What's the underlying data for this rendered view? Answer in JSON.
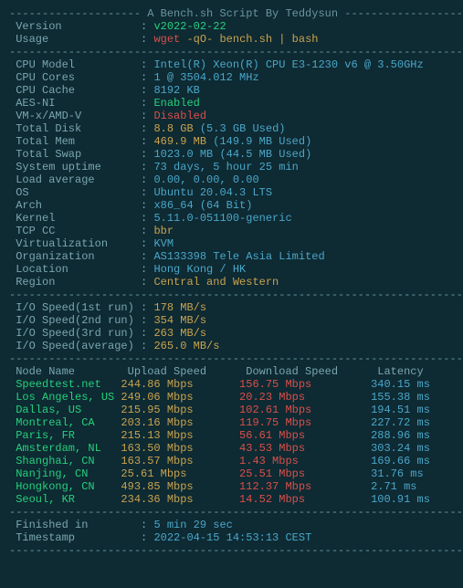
{
  "header": "-------------------- A Bench.sh Script By Teddysun --------------------",
  "sep": "-----------------------------------------------------------------------",
  "sep2": "----------------------------------------------------------------------",
  "meta": {
    "version_lbl": " Version            ",
    "version": "v2022-02-22",
    "usage_lbl": " Usage              ",
    "usage_w": "wget",
    "usage_o": " -qO- ",
    "usage_b": "bench.sh ",
    "usage_p": "|",
    "usage_ba": " bash"
  },
  "sys": {
    "cpu_model_lbl": " CPU Model          ",
    "cpu_model": "Intel(R) Xeon(R) CPU E3-1230 v6 @ 3.50GHz",
    "cpu_cores_lbl": " CPU Cores          ",
    "cpu_cores": "1 @ 3504.012 MHz",
    "cpu_cache_lbl": " CPU Cache          ",
    "cpu_cache": "8192 KB",
    "aesni_lbl": " AES-NI             ",
    "aesni": "Enabled",
    "vmx_lbl": " VM-x/AMD-V         ",
    "vmx": "Disabled",
    "disk_lbl": " Total Disk         ",
    "disk": "8.8 GB ",
    "disk_used": "(5.3 GB Used)",
    "mem_lbl": " Total Mem          ",
    "mem": "469.9 MB ",
    "mem_used": "(149.9 MB Used)",
    "swap_lbl": " Total Swap         ",
    "swap": "1023.0 MB ",
    "swap_used": "(44.5 MB Used)",
    "uptime_lbl": " System uptime      ",
    "uptime": "73 days, 5 hour 25 min",
    "load_lbl": " Load average       ",
    "load": "0.00, 0.00, 0.00",
    "os_lbl": " OS                 ",
    "os": "Ubuntu 20.04.3 LTS",
    "arch_lbl": " Arch               ",
    "arch": "x86_64 (64 Bit)",
    "kernel_lbl": " Kernel             ",
    "kernel": "5.11.0-051100-generic",
    "tcpcc_lbl": " TCP CC             ",
    "tcpcc": "bbr",
    "virt_lbl": " Virtualization     ",
    "virt": "KVM",
    "org_lbl": " Organization       ",
    "org": "AS133398 Tele Asia Limited",
    "loc_lbl": " Location           ",
    "loc": "Hong Kong / HK",
    "region_lbl": " Region             ",
    "region": "Central and Western"
  },
  "io": {
    "r1_lbl": " I/O Speed(1st run) ",
    "r1": "178 MB/s",
    "r2_lbl": " I/O Speed(2nd run) ",
    "r2": "354 MB/s",
    "r3_lbl": " I/O Speed(3rd run) ",
    "r3": "263 MB/s",
    "avg_lbl": " I/O Speed(average) ",
    "avg": "265.0 MB/s"
  },
  "net_hdr": " Node Name        Upload Speed      Download Speed      Latency    ",
  "net": [
    {
      "n": " Speedtest.net   ",
      "u": "244.86 Mbps       ",
      "d": "156.75 Mbps         ",
      "l": "340.15 ms"
    },
    {
      "n": " Los Angeles, US ",
      "u": "249.06 Mbps       ",
      "d": "20.23 Mbps          ",
      "l": "155.38 ms"
    },
    {
      "n": " Dallas, US      ",
      "u": "215.95 Mbps       ",
      "d": "102.61 Mbps         ",
      "l": "194.51 ms"
    },
    {
      "n": " Montreal, CA    ",
      "u": "203.16 Mbps       ",
      "d": "119.75 Mbps         ",
      "l": "227.72 ms"
    },
    {
      "n": " Paris, FR       ",
      "u": "215.13 Mbps       ",
      "d": "56.61 Mbps          ",
      "l": "288.96 ms"
    },
    {
      "n": " Amsterdam, NL   ",
      "u": "163.50 Mbps       ",
      "d": "43.53 Mbps          ",
      "l": "303.24 ms"
    },
    {
      "n": " Shanghai, CN    ",
      "u": "163.57 Mbps       ",
      "d": "1.43 Mbps           ",
      "l": "169.66 ms"
    },
    {
      "n": " Nanjing, CN     ",
      "u": "25.61 Mbps        ",
      "d": "25.51 Mbps          ",
      "l": "31.76 ms"
    },
    {
      "n": " Hongkong, CN    ",
      "u": "493.85 Mbps       ",
      "d": "112.37 Mbps         ",
      "l": "2.71 ms"
    },
    {
      "n": " Seoul, KR       ",
      "u": "234.36 Mbps       ",
      "d": "14.52 Mbps          ",
      "l": "100.91 ms"
    }
  ],
  "fin": {
    "fin_lbl": " Finished in        ",
    "fin": "5 min 29 sec",
    "ts_lbl": " Timestamp          ",
    "ts": "2022-04-15 14:53:13 CEST"
  },
  "colon": ": "
}
